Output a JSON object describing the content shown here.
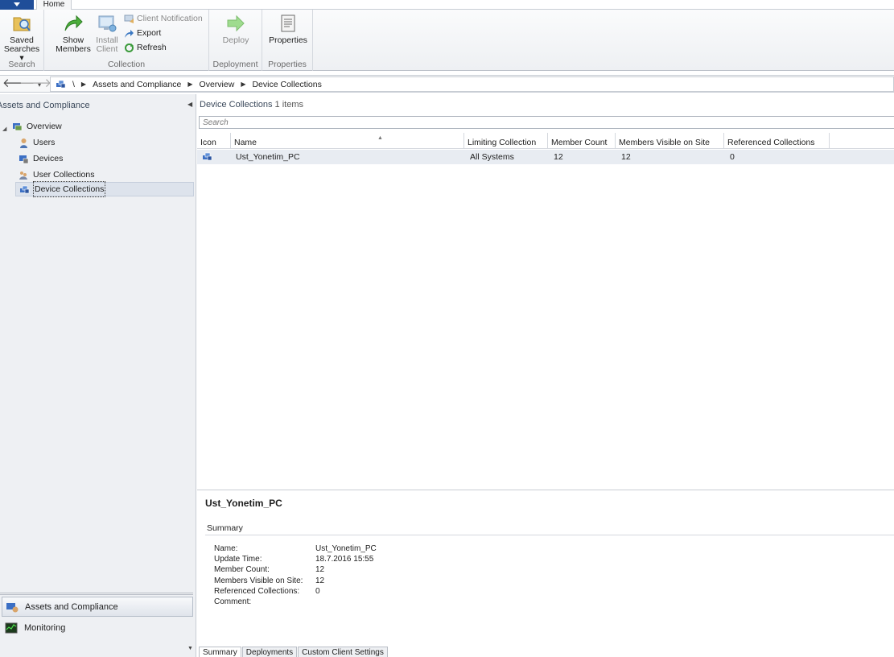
{
  "ribbon": {
    "tab_home": "Home",
    "groups": {
      "search": "Search",
      "collection": "Collection",
      "deployment": "Deployment",
      "properties": "Properties"
    },
    "buttons": {
      "saved_searches_1": "Saved",
      "saved_searches_2": "Searches",
      "show_members_1": "Show",
      "show_members_2": "Members",
      "install_client_1": "Install",
      "install_client_2": "Client",
      "client_notification": "Client Notification",
      "export": "Export",
      "refresh": "Refresh",
      "deploy": "Deploy",
      "properties": "Properties"
    }
  },
  "address": {
    "root": "\\",
    "crumbs": [
      "Assets and Compliance",
      "Overview",
      "Device Collections"
    ]
  },
  "nav": {
    "title": "Assets and Compliance",
    "overview": "Overview",
    "items": [
      "Users",
      "Devices",
      "User Collections",
      "Device Collections"
    ],
    "workspaces": [
      "Assets and Compliance",
      "Monitoring"
    ]
  },
  "list": {
    "title": "Device Collections",
    "count": "1 items",
    "search_placeholder": "Search",
    "columns": [
      "Icon",
      "Name",
      "Limiting Collection",
      "Member Count",
      "Members Visible on Site",
      "Referenced Collections"
    ],
    "rows": [
      {
        "name": "Ust_Yonetim_PC",
        "limiting": "All Systems",
        "member_count": "12",
        "visible": "12",
        "referenced": "0"
      }
    ]
  },
  "details": {
    "title": "Ust_Yonetim_PC",
    "section": "Summary",
    "fields": [
      {
        "k": "Name:",
        "v": "Ust_Yonetim_PC"
      },
      {
        "k": "Update Time:",
        "v": "18.7.2016 15:55"
      },
      {
        "k": "Member Count:",
        "v": "12"
      },
      {
        "k": "Members Visible on Site:",
        "v": "12"
      },
      {
        "k": "Referenced Collections:",
        "v": "0"
      },
      {
        "k": "Comment:",
        "v": ""
      }
    ],
    "tabs": [
      "Summary",
      "Deployments",
      "Custom Client Settings"
    ]
  }
}
